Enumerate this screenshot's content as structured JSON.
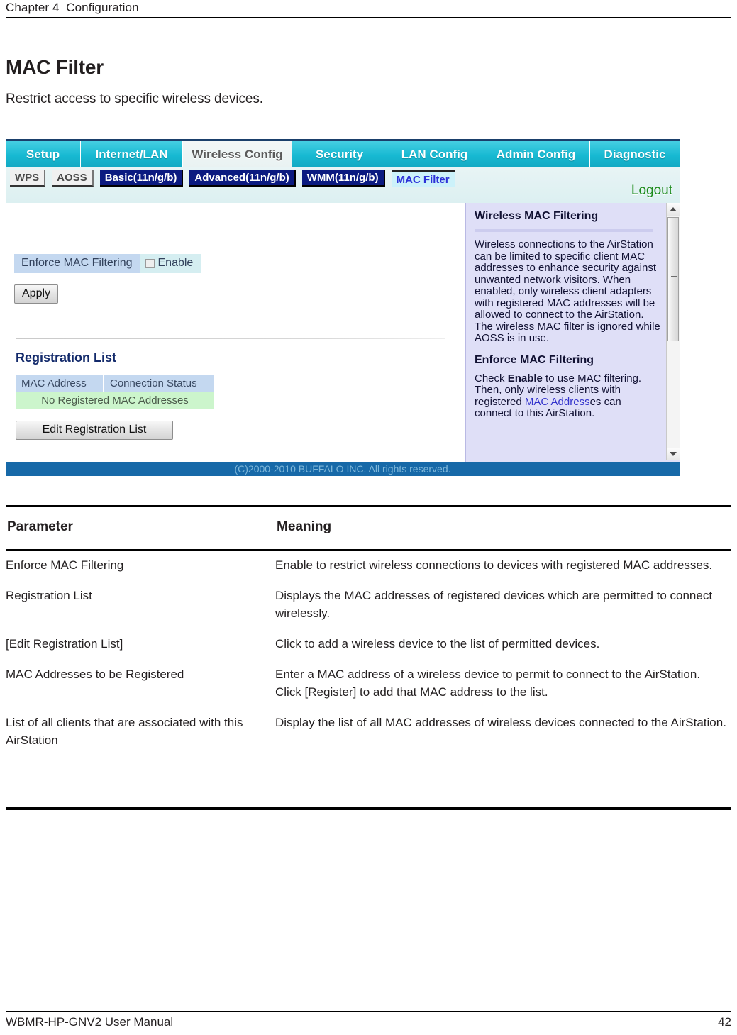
{
  "page": {
    "running_head": "Chapter 4  Configuration",
    "section_title": "MAC Filter",
    "section_subtitle": "Restrict access to specific wireless devices.",
    "footer_left": "WBMR-HP-GNV2 User Manual",
    "footer_page": "42"
  },
  "screenshot": {
    "main_tabs": [
      {
        "label": "Setup",
        "active": false
      },
      {
        "label": "Internet/LAN",
        "active": false
      },
      {
        "label": "Wireless Config",
        "active": true
      },
      {
        "label": "Security",
        "active": false
      },
      {
        "label": "LAN Config",
        "active": false
      },
      {
        "label": "Admin Config",
        "active": false
      },
      {
        "label": "Diagnostic",
        "active": false
      }
    ],
    "sub_tabs": [
      {
        "label": "WPS",
        "style": "gray"
      },
      {
        "label": "AOSS",
        "style": "gray"
      },
      {
        "label": "Basic(11n/g/b)",
        "style": "navy"
      },
      {
        "label": "Advanced(11n/g/b)",
        "style": "navy"
      },
      {
        "label": "WMM(11n/g/b)",
        "style": "navy"
      },
      {
        "label": "MAC Filter",
        "style": "current"
      }
    ],
    "logout_label": "Logout",
    "form": {
      "enforce_label": "Enforce MAC Filtering",
      "enable_label": "Enable",
      "enable_checked": false,
      "apply_label": "Apply"
    },
    "registration": {
      "title": "Registration List",
      "columns": [
        "MAC Address",
        "Connection Status"
      ],
      "empty_message": "No Registered MAC Addresses",
      "edit_button": "Edit Registration List"
    },
    "help": {
      "heading": "Wireless MAC Filtering",
      "body": "Wireless connections to the AirStation can be limited to specific client MAC addresses to enhance security against unwanted network visitors. When enabled, only wireless client adapters with registered MAC addresses will be allowed to connect to the AirStation. The wireless MAC filter is ignored while AOSS is in use.",
      "heading2": "Enforce MAC Filtering",
      "body2_pre": "Check ",
      "body2_bold": "Enable",
      "body2_mid": " to use MAC filtering. Then, only wireless clients with registered ",
      "body2_link": "MAC Address",
      "body2_post": "es can connect to this AirStation."
    },
    "copyright": "(C)2000-2010 BUFFALO INC. All rights reserved."
  },
  "table": {
    "headers": {
      "parameter": "Parameter",
      "meaning": "Meaning"
    },
    "rows": [
      {
        "parameter": "Enforce MAC Filtering",
        "meaning": "Enable to restrict wireless connections to devices with registered MAC addresses."
      },
      {
        "parameter": "Registration List",
        "meaning": "Displays the MAC addresses of registered devices which are permitted to connect wirelessly."
      },
      {
        "parameter": "[Edit Registration List]",
        "meaning": "Click to add a wireless device to the list of permitted devices."
      },
      {
        "parameter": "MAC Addresses to be Registered",
        "meaning": "Enter a MAC address of a wireless device to permit to connect to the AirStation. Click [Register] to add that MAC address to the list."
      },
      {
        "parameter": "List of all clients that are associated with this AirStation",
        "meaning": "Display the list of all MAC addresses of wireless devices connected to the AirStation."
      }
    ]
  }
}
